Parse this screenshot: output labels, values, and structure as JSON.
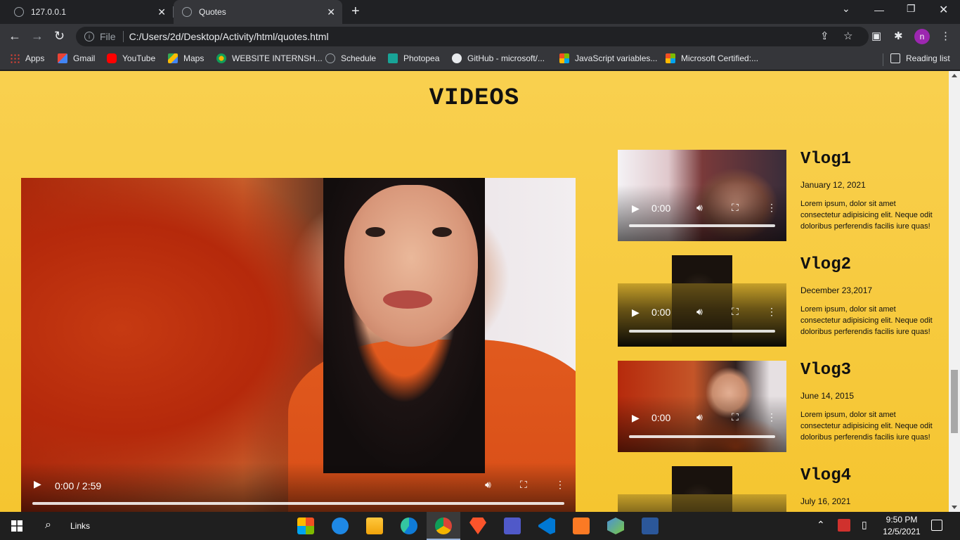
{
  "browser": {
    "tabs": [
      {
        "title": "127.0.0.1",
        "active": false
      },
      {
        "title": "Quotes",
        "active": true
      }
    ],
    "omnibox": {
      "scheme_label": "File",
      "url": "C:/Users/2d/Desktop/Activity/html/quotes.html"
    },
    "bookmarks": [
      "Apps",
      "Gmail",
      "YouTube",
      "Maps",
      "WEBSITE INTERNSH...",
      "Schedule",
      "Photopea",
      "GitHub - microsoft/...",
      "JavaScript variables...",
      "Microsoft Certified:..."
    ],
    "reading_list": "Reading list",
    "profile_initial": "n"
  },
  "page": {
    "title": "VIDEOS",
    "main_video": {
      "time": "0:00 / 2:59"
    },
    "vlogs": [
      {
        "title": "Vlog1",
        "date": "January 12, 2021",
        "text": "Lorem ipsum, dolor sit amet consectetur adipisicing elit. Neque odit doloribus perferendis facilis iure quas!",
        "time": "0:00"
      },
      {
        "title": "Vlog2",
        "date": "December 23,2017",
        "text": "Lorem ipsum, dolor sit amet consectetur adipisicing elit. Neque odit doloribus perferendis facilis iure quas!",
        "time": "0:00"
      },
      {
        "title": "Vlog3",
        "date": "June 14, 2015",
        "text": "Lorem ipsum, dolor sit amet consectetur adipisicing elit. Neque odit doloribus perferendis facilis iure quas!",
        "time": "0:00"
      },
      {
        "title": "Vlog4",
        "date": "July 16, 2021",
        "text": "",
        "time": ""
      }
    ]
  },
  "taskbar": {
    "search_label": "Links",
    "time": "9:50 PM",
    "date": "12/5/2021"
  },
  "colors": {
    "page_bg": "#f7c83a",
    "chrome_dark": "#202124",
    "chrome_toolbar": "#35363a"
  }
}
